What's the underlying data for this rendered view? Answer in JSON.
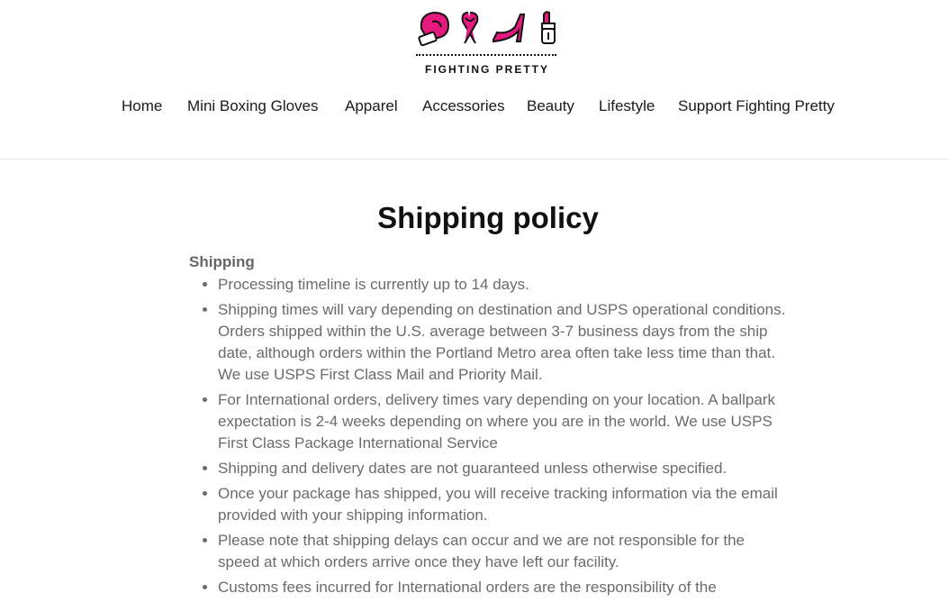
{
  "brand": {
    "name": "FIGHTING PRETTY",
    "accent_color": "#e6197e",
    "logo_icons": [
      "boxing-glove-icon",
      "ribbon-icon",
      "high-heel-icon",
      "lipstick-icon"
    ]
  },
  "nav": {
    "items": [
      {
        "label": "Home"
      },
      {
        "label": "Mini Boxing Gloves"
      },
      {
        "label": "Apparel"
      },
      {
        "label": "Accessories"
      },
      {
        "label": "Beauty"
      },
      {
        "label": "Lifestyle"
      },
      {
        "label": "Support Fighting Pretty"
      }
    ]
  },
  "page": {
    "title": "Shipping policy",
    "section_title": "Shipping",
    "bullets": [
      "Processing timeline is currently up to 14 days.",
      "Shipping times will vary depending on destination and USPS operational conditions. Orders shipped within the U.S. average between 3-7 business days from the ship date, although orders within the Portland Metro area often take less time than that. We use USPS First Class Mail and Priority Mail.",
      "For International orders, delivery times vary depending on your location. A ballpark expectation is 2-4 weeks depending on where you are in the world. We use USPS First Class Package International Service",
      "Shipping and delivery dates are not guaranteed unless otherwise specified.",
      "Once your package has shipped, you will receive tracking information via the email provided with your shipping information.",
      "Please note that shipping delays can occur and we are not responsible for the speed at which orders arrive once they have left our facility.",
      "Customs fees incurred for International orders are the responsibility of the"
    ]
  }
}
